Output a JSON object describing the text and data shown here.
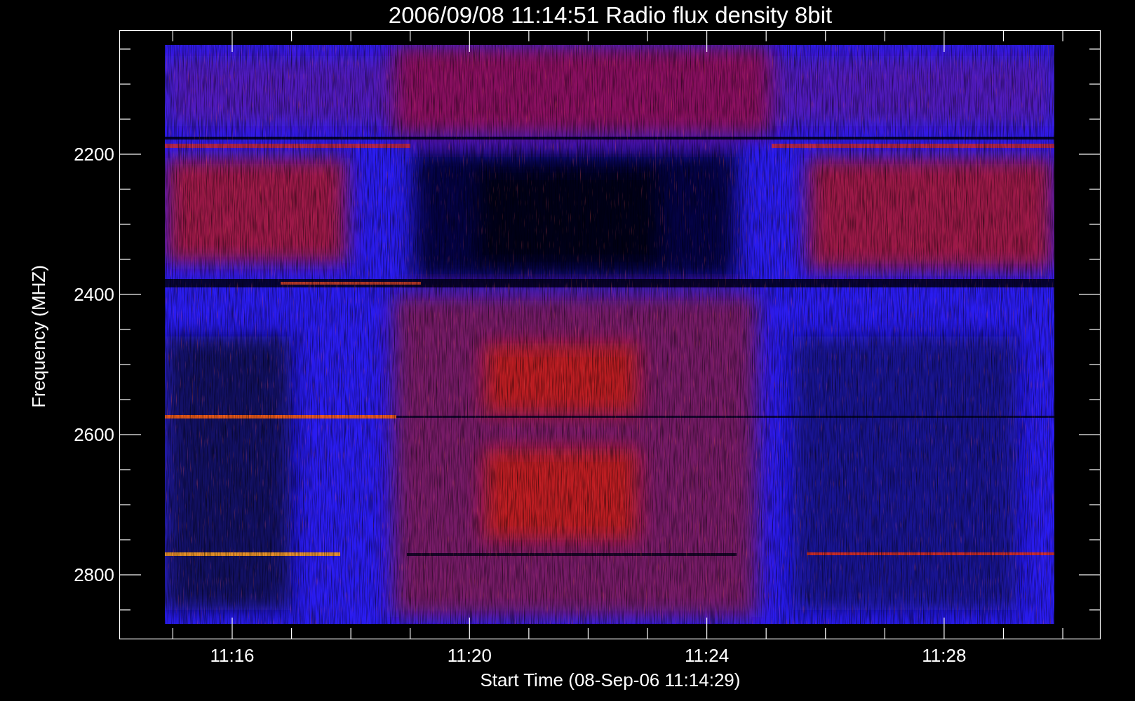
{
  "title": "2006/09/08 11:14:51 Radio flux density 8bit",
  "x_axis": {
    "label": "Start Time (08-Sep-06 11:14:29)",
    "ticks": [
      "11:16",
      "11:20",
      "11:24",
      "11:28"
    ]
  },
  "y_axis": {
    "label": "Frequency (MHZ)",
    "ticks": [
      "2200",
      "2400",
      "2600",
      "2800"
    ]
  }
}
